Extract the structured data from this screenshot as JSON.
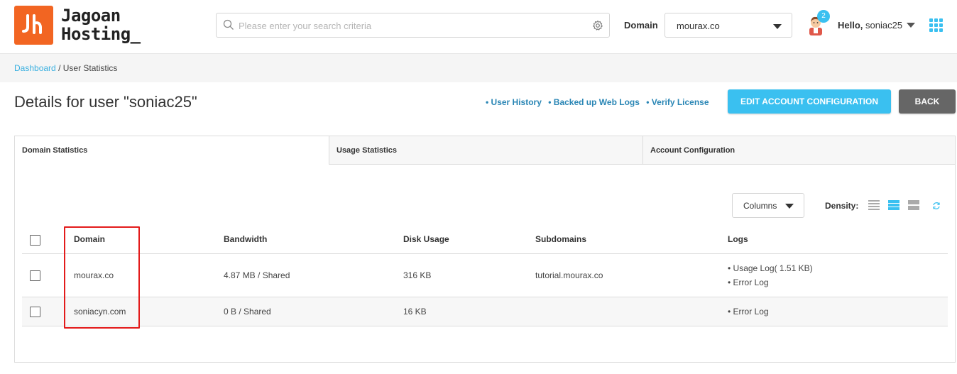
{
  "brand": {
    "line1": "Jagoan",
    "line2": "Hosting_",
    "logo_color": "#f26522"
  },
  "search": {
    "placeholder": "Please enter your search criteria",
    "value": ""
  },
  "domain_picker": {
    "label": "Domain",
    "selected": "mourax.co"
  },
  "user": {
    "notification_count": "2",
    "greeting": "Hello,",
    "username": "soniac25"
  },
  "breadcrumb": {
    "home": "Dashboard",
    "separator": "/",
    "current": "User Statistics"
  },
  "page": {
    "title": "Details for user \"soniac25\"",
    "links": [
      "• User History",
      "• Backed up Web Logs",
      "• Verify License"
    ],
    "edit_button": "EDIT ACCOUNT CONFIGURATION",
    "back_button": "BACK"
  },
  "tabs": [
    {
      "label": "Domain Statistics",
      "active": true
    },
    {
      "label": "Usage Statistics",
      "active": false
    },
    {
      "label": "Account Configuration",
      "active": false
    }
  ],
  "toolbar": {
    "columns_label": "Columns",
    "density_label": "Density:",
    "density_selected": "medium"
  },
  "table": {
    "headers": [
      "Domain",
      "Bandwidth",
      "Disk Usage",
      "Subdomains",
      "Logs"
    ],
    "rows": [
      {
        "domain": "mourax.co",
        "bandwidth": "4.87 MB / Shared",
        "disk": "316 KB",
        "subdomains": "tutorial.mourax.co",
        "logs": [
          "• Usage Log( 1.51 KB)",
          "• Error Log"
        ]
      },
      {
        "domain": "soniacyn.com",
        "bandwidth": "0 B / Shared",
        "disk": "16 KB",
        "subdomains": "",
        "logs": [
          "• Error Log"
        ]
      }
    ]
  },
  "colors": {
    "accent": "#3ac0f0",
    "link": "#2a86b5",
    "highlight": "#e31b1b",
    "back_button": "#666666"
  }
}
